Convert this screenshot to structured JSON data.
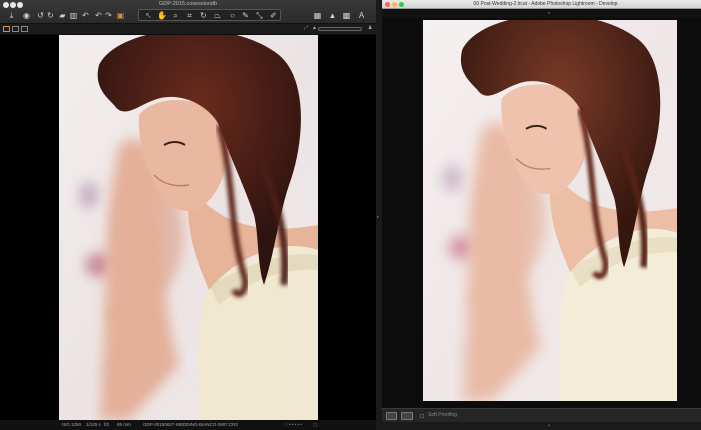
{
  "capture_one": {
    "title": "GDP-2015.cosessiondb",
    "status": {
      "iso": "ISO 1250",
      "shutter": "1/125 s",
      "aperture": "f/2",
      "focal": "85 mm",
      "filename": "GDP-20150827-WEDDING-BIANCO-2807.CR2"
    },
    "icons": [
      "import-icon",
      "camera-icon",
      "undo-icon",
      "redo-icon",
      "folder-icon",
      "trash-icon",
      "rotate-left-icon",
      "rotate-right-icon",
      "stack-icon",
      "cursor-icon",
      "pan-icon",
      "loupe-icon",
      "crop-icon",
      "rotate-icon",
      "keystone-icon",
      "spot-icon",
      "brush-icon",
      "gradient-icon",
      "picker-icon",
      "grid-icon",
      "warning-icon",
      "compare-icon",
      "text-icon"
    ]
  },
  "lightroom": {
    "title": "00 Post-Wedding-2.lrcat - Adobe Photoshop Lightroom - Develop",
    "soft_proofing_label": "Soft Proofing",
    "colors": {
      "close": "#fc605c",
      "minimize": "#fdbc40",
      "zoom": "#34c84a"
    }
  },
  "accent_color": "#e08a3a"
}
